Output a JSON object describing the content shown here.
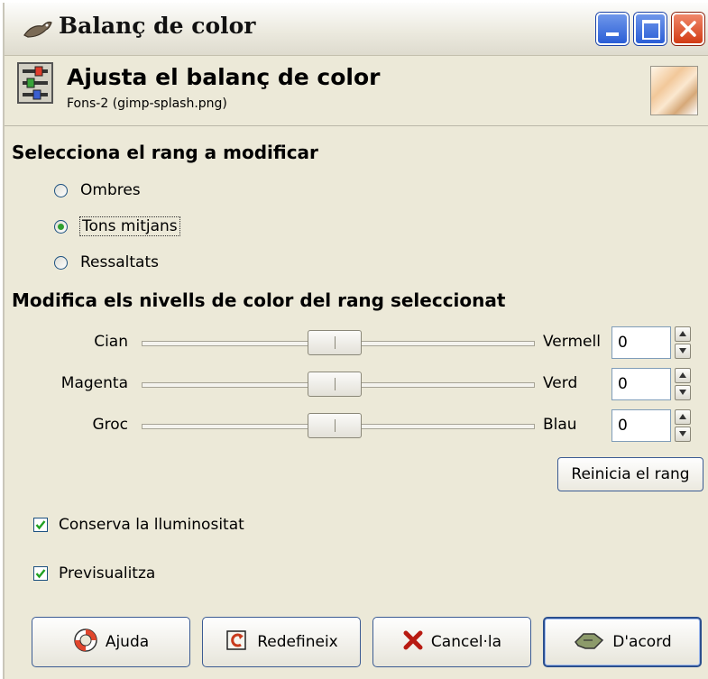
{
  "window": {
    "title": "Balanç de color",
    "buttons": [
      "minimize",
      "maximize",
      "close"
    ]
  },
  "header": {
    "title": "Ajusta el balanç de color",
    "subtitle": "Fons-2 (gimp-splash.png)"
  },
  "range": {
    "heading": "Selecciona el rang a modificar",
    "options": [
      {
        "label": "Ombres",
        "selected": false
      },
      {
        "label": "Tons mitjans",
        "selected": true
      },
      {
        "label": "Ressaltats",
        "selected": false
      }
    ]
  },
  "levels": {
    "heading": "Modifica els nivells de color del rang seleccionat",
    "sliders": [
      {
        "left": "Cian",
        "right": "Vermell",
        "value": "0"
      },
      {
        "left": "Magenta",
        "right": "Verd",
        "value": "0"
      },
      {
        "left": "Groc",
        "right": "Blau",
        "value": "0"
      }
    ],
    "reset_label": "Reinicia el rang"
  },
  "options": {
    "preserve_luminosity": {
      "label": "Conserva la lluminositat",
      "checked": true
    },
    "preview": {
      "label": "Previsualitza",
      "checked": true
    }
  },
  "buttons": {
    "help": "Ajuda",
    "reset": "Redefineix",
    "cancel": "Cancel·la",
    "ok": "D'acord"
  },
  "colors": {
    "dialog_bg": "#ece9d8",
    "xp_blue": "#2a5ed6",
    "close_red": "#d23b14",
    "radio_green": "#2fa02f"
  }
}
